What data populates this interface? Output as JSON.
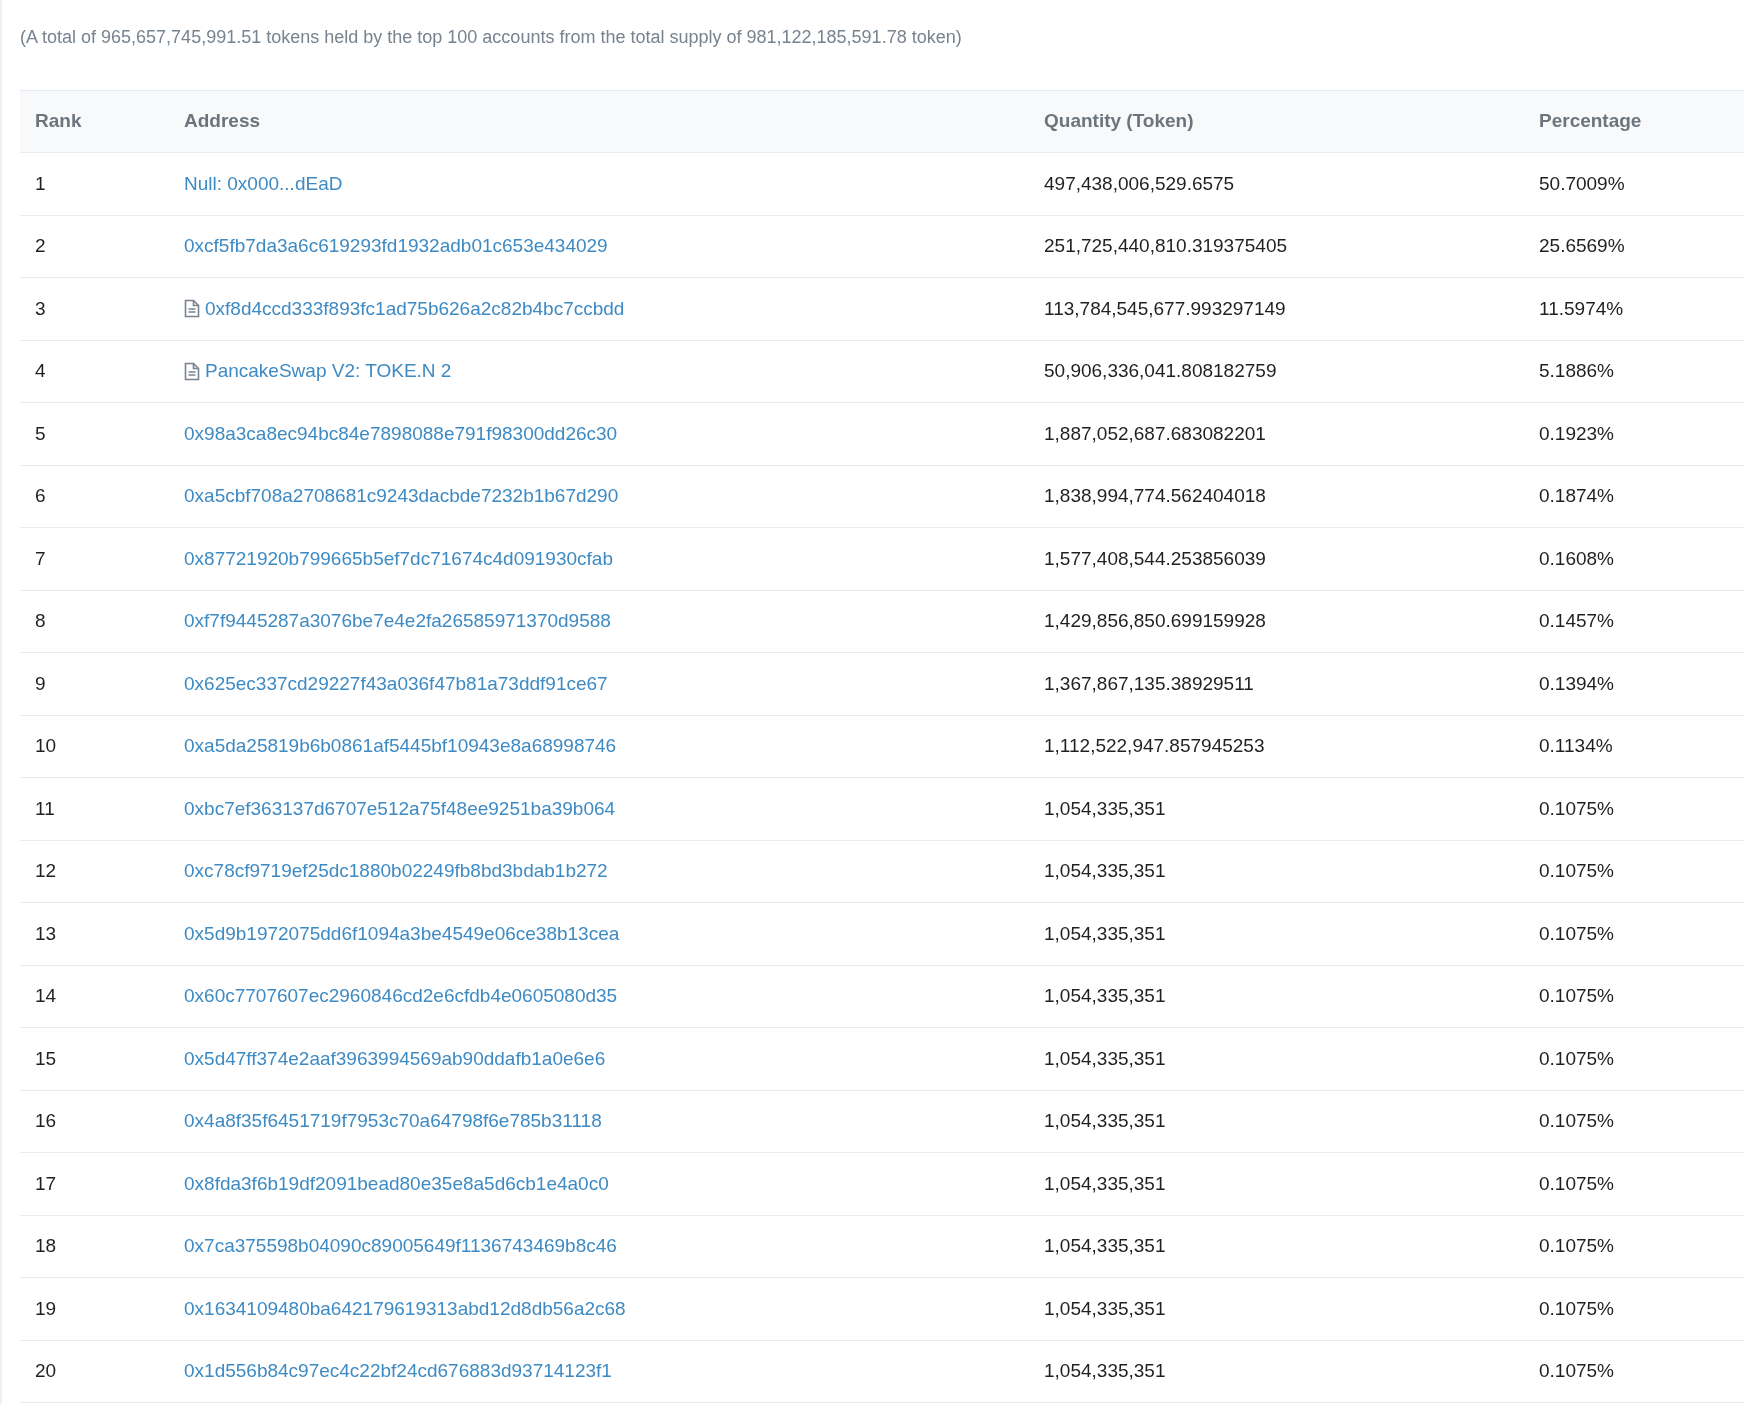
{
  "summary": "(A total of 965,657,745,991.51 tokens held by the top 100 accounts from the total supply of 981,122,185,591.78 token)",
  "table": {
    "columns": [
      "Rank",
      "Address",
      "Quantity (Token)",
      "Percentage"
    ],
    "rows": [
      {
        "rank": "1",
        "kind": "account",
        "address": "Null: 0x000...dEaD",
        "quantity": "497,438,006,529.6575",
        "percentage": "50.7009%"
      },
      {
        "rank": "2",
        "kind": "account",
        "address": "0xcf5fb7da3a6c619293fd1932adb01c653e434029",
        "quantity": "251,725,440,810.319375405",
        "percentage": "25.6569%"
      },
      {
        "rank": "3",
        "kind": "contract",
        "address": "0xf8d4ccd333f893fc1ad75b626a2c82b4bc7ccbdd",
        "quantity": "113,784,545,677.993297149",
        "percentage": "11.5974%"
      },
      {
        "rank": "4",
        "kind": "contract",
        "address": "PancakeSwap V2: TOKE.N 2",
        "quantity": "50,906,336,041.808182759",
        "percentage": "5.1886%"
      },
      {
        "rank": "5",
        "kind": "account",
        "address": "0x98a3ca8ec94bc84e7898088e791f98300dd26c30",
        "quantity": "1,887,052,687.683082201",
        "percentage": "0.1923%"
      },
      {
        "rank": "6",
        "kind": "account",
        "address": "0xa5cbf708a2708681c9243dacbde7232b1b67d290",
        "quantity": "1,838,994,774.562404018",
        "percentage": "0.1874%"
      },
      {
        "rank": "7",
        "kind": "account",
        "address": "0x87721920b799665b5ef7dc71674c4d091930cfab",
        "quantity": "1,577,408,544.253856039",
        "percentage": "0.1608%"
      },
      {
        "rank": "8",
        "kind": "account",
        "address": "0xf7f9445287a3076be7e4e2fa26585971370d9588",
        "quantity": "1,429,856,850.699159928",
        "percentage": "0.1457%"
      },
      {
        "rank": "9",
        "kind": "account",
        "address": "0x625ec337cd29227f43a036f47b81a73ddf91ce67",
        "quantity": "1,367,867,135.38929511",
        "percentage": "0.1394%"
      },
      {
        "rank": "10",
        "kind": "account",
        "address": "0xa5da25819b6b0861af5445bf10943e8a68998746",
        "quantity": "1,112,522,947.857945253",
        "percentage": "0.1134%"
      },
      {
        "rank": "11",
        "kind": "account",
        "address": "0xbc7ef363137d6707e512a75f48ee9251ba39b064",
        "quantity": "1,054,335,351",
        "percentage": "0.1075%"
      },
      {
        "rank": "12",
        "kind": "account",
        "address": "0xc78cf9719ef25dc1880b02249fb8bd3bdab1b272",
        "quantity": "1,054,335,351",
        "percentage": "0.1075%"
      },
      {
        "rank": "13",
        "kind": "account",
        "address": "0x5d9b1972075dd6f1094a3be4549e06ce38b13cea",
        "quantity": "1,054,335,351",
        "percentage": "0.1075%"
      },
      {
        "rank": "14",
        "kind": "account",
        "address": "0x60c7707607ec2960846cd2e6cfdb4e0605080d35",
        "quantity": "1,054,335,351",
        "percentage": "0.1075%"
      },
      {
        "rank": "15",
        "kind": "account",
        "address": "0x5d47ff374e2aaf3963994569ab90ddafb1a0e6e6",
        "quantity": "1,054,335,351",
        "percentage": "0.1075%"
      },
      {
        "rank": "16",
        "kind": "account",
        "address": "0x4a8f35f6451719f7953c70a64798f6e785b31118",
        "quantity": "1,054,335,351",
        "percentage": "0.1075%"
      },
      {
        "rank": "17",
        "kind": "account",
        "address": "0x8fda3f6b19df2091bead80e35e8a5d6cb1e4a0c0",
        "quantity": "1,054,335,351",
        "percentage": "0.1075%"
      },
      {
        "rank": "18",
        "kind": "account",
        "address": "0x7ca375598b04090c89005649f1136743469b8c46",
        "quantity": "1,054,335,351",
        "percentage": "0.1075%"
      },
      {
        "rank": "19",
        "kind": "account",
        "address": "0x1634109480ba642179619313abd12d8db56a2c68",
        "quantity": "1,054,335,351",
        "percentage": "0.1075%"
      },
      {
        "rank": "20",
        "kind": "account",
        "address": "0x1d556b84c97ec4c22bf24cd676883d93714123f1",
        "quantity": "1,054,335,351",
        "percentage": "0.1075%"
      }
    ]
  }
}
